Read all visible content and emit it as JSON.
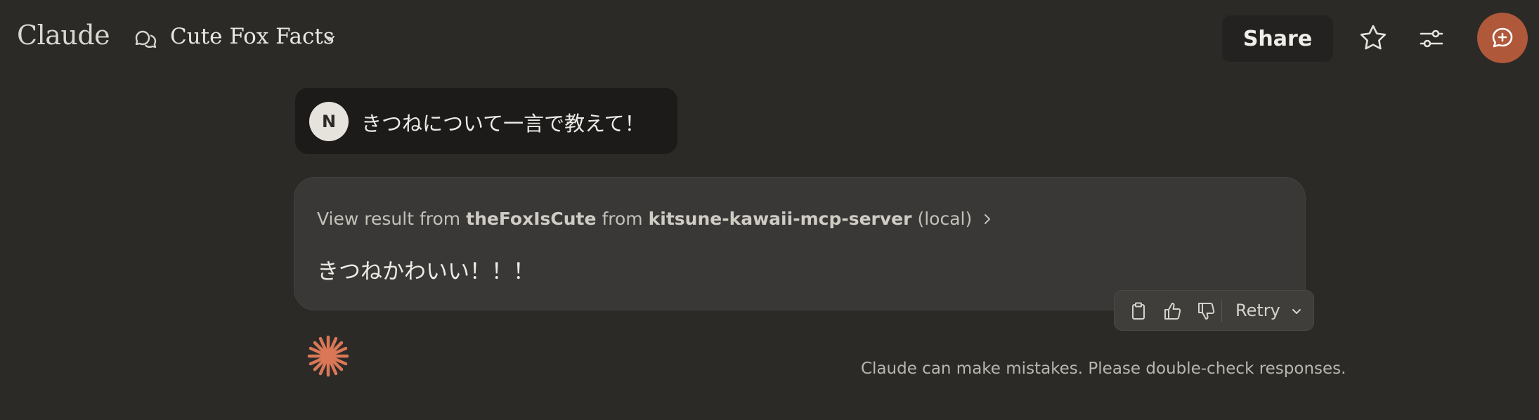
{
  "app": {
    "logo": "Claude",
    "accent_color": "#b0583a",
    "spark_color": "#d97757"
  },
  "header": {
    "conversation_title": "Cute Fox Facts",
    "share_label": "Share",
    "icons": [
      "chat-bubbles-icon",
      "chevron-down-icon",
      "star-icon",
      "sliders-icon",
      "new-chat-icon"
    ]
  },
  "messages": {
    "user": {
      "avatar_initial": "N",
      "text": "きつねについて一言で教えて！"
    },
    "assistant": {
      "tool_prefix": "View result from",
      "tool_name": "theFoxIsCute",
      "tool_from": "from",
      "server_name": "kitsune-kawaii-mcp-server",
      "server_scope": "(local)",
      "answer": "きつねかわいい！！！"
    }
  },
  "actions": {
    "retry_label": "Retry",
    "icons": [
      "copy-icon",
      "thumbs-up-icon",
      "thumbs-down-icon",
      "chevron-down-icon"
    ]
  },
  "footer": {
    "disclaimer": "Claude can make mistakes. Please double-check responses."
  }
}
